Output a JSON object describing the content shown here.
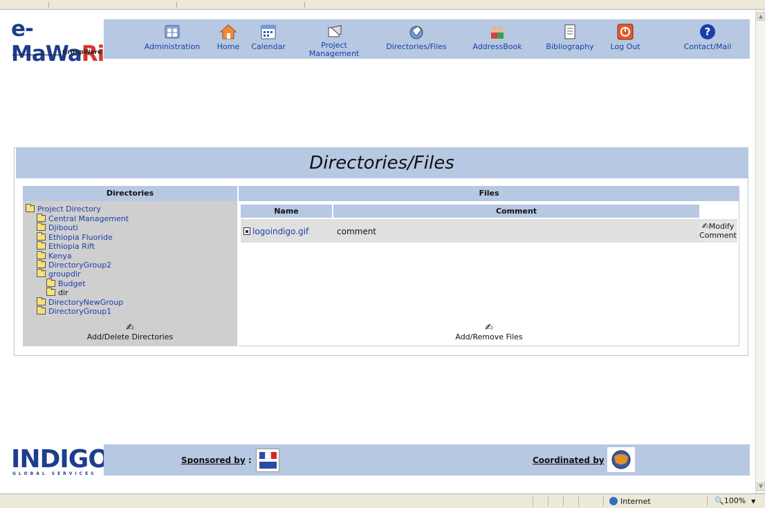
{
  "header": {
    "logo": {
      "main": "e-MaWaRi",
      "sub": "GroupWare"
    },
    "nav": [
      {
        "label": "Administration",
        "icon": "administration-icon"
      },
      {
        "label": "Home",
        "icon": "home-icon"
      },
      {
        "label": "Calendar",
        "icon": "calendar-icon"
      },
      {
        "label_line1": "Project",
        "label_line2": "Management",
        "icon": "project-management-icon"
      },
      {
        "label": "Directories/Files",
        "icon": "directories-files-icon"
      },
      {
        "label": "AddressBook",
        "icon": "addressbook-icon"
      },
      {
        "label": "Bibliography",
        "icon": "bibliography-icon"
      },
      {
        "label": "Log Out",
        "icon": "logout-icon"
      },
      {
        "label": "Contact/Mail",
        "icon": "contact-mail-icon"
      }
    ]
  },
  "main": {
    "title": "Directories/Files",
    "directories": {
      "heading": "Directories",
      "tree": [
        {
          "label": "Project Directory",
          "level": 0
        },
        {
          "label": "Central Management",
          "level": 1
        },
        {
          "label": "Djibouti",
          "level": 1
        },
        {
          "label": "Ethiopia Fluoride",
          "level": 1
        },
        {
          "label": "Ethiopia Rift",
          "level": 1
        },
        {
          "label": "Kenya",
          "level": 1
        },
        {
          "label": "DirectoryGroup2",
          "level": 1
        },
        {
          "label": "groupdir",
          "level": 1
        },
        {
          "label": "Budget",
          "level": 2
        },
        {
          "label": "dir",
          "level": 2
        },
        {
          "label": "DirectoryNewGroup",
          "level": 1
        },
        {
          "label": "DirectoryGroup1",
          "level": 1
        }
      ],
      "action": "Add/Delete Directories"
    },
    "files": {
      "heading": "Files",
      "columns": [
        "Name",
        "Comment"
      ],
      "rows": [
        {
          "name": "logoindigo.gif",
          "comment": "comment",
          "action_line1": "Modify",
          "action_line2": "Comment"
        }
      ],
      "action": "Add/Remove Files"
    }
  },
  "footer": {
    "logo_main": "INDIGO",
    "logo_sub": "GLOBAL SERVICES",
    "sponsored": "Sponsored by",
    "coordinated": "Coordinated by",
    "separator": ":"
  },
  "statusbar": {
    "zone": "Internet",
    "zoom": "100%"
  },
  "colors": {
    "accent": "#b6c8e2",
    "link": "#1b3fa8",
    "pane": "#cfcfcf"
  }
}
